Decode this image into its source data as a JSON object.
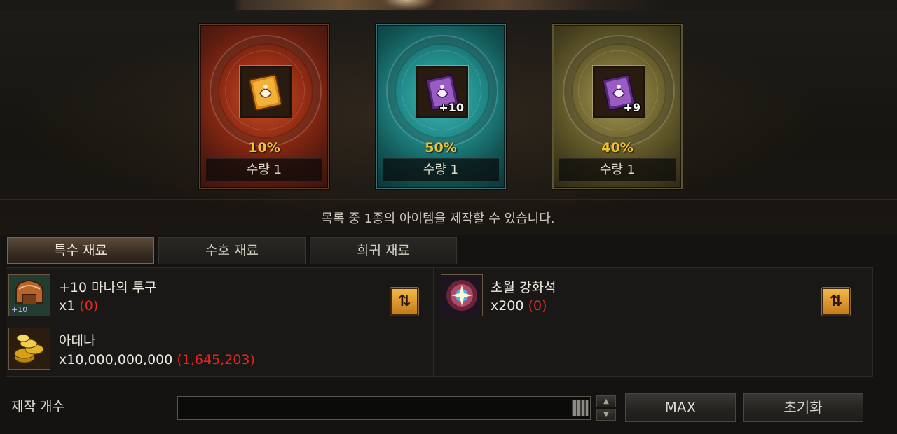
{
  "results": [
    {
      "chance": "10%",
      "quantity": "수량 1",
      "plus": "",
      "theme": "red",
      "icon": "orange-scroll-icon"
    },
    {
      "chance": "50%",
      "quantity": "수량 1",
      "plus": "+10",
      "theme": "teal",
      "icon": "purple-scroll-icon"
    },
    {
      "chance": "40%",
      "quantity": "수량 1",
      "plus": "+9",
      "theme": "olive",
      "icon": "purple-scroll-icon"
    }
  ],
  "notice": "목록 중 1종의 아이템을 제작할 수 있습니다.",
  "tabs": [
    {
      "label": "특수 재료",
      "active": true
    },
    {
      "label": "수호 재료",
      "active": false
    },
    {
      "label": "희귀 재료",
      "active": false
    }
  ],
  "materials": {
    "left": [
      {
        "name": "+10 마나의 투구",
        "count": "x1",
        "have": "(0)",
        "icon": "helmet-icon",
        "enchant": "+10"
      },
      {
        "name": "아데나",
        "count": "x10,000,000,000",
        "have": "(1,645,203)",
        "icon": "adena-coins-icon"
      }
    ],
    "right": [
      {
        "name": "초월 강화석",
        "count": "x200",
        "have": "(0)",
        "icon": "enhance-stone-icon"
      }
    ]
  },
  "bottom": {
    "craft_count_label": "제작 개수",
    "input_value": "",
    "max_label": "MAX",
    "reset_label": "초기화"
  },
  "colors": {
    "chance_text": "#f2c22e",
    "owned_shortage": "#e5261d",
    "swap_button": "#e09a2a"
  }
}
